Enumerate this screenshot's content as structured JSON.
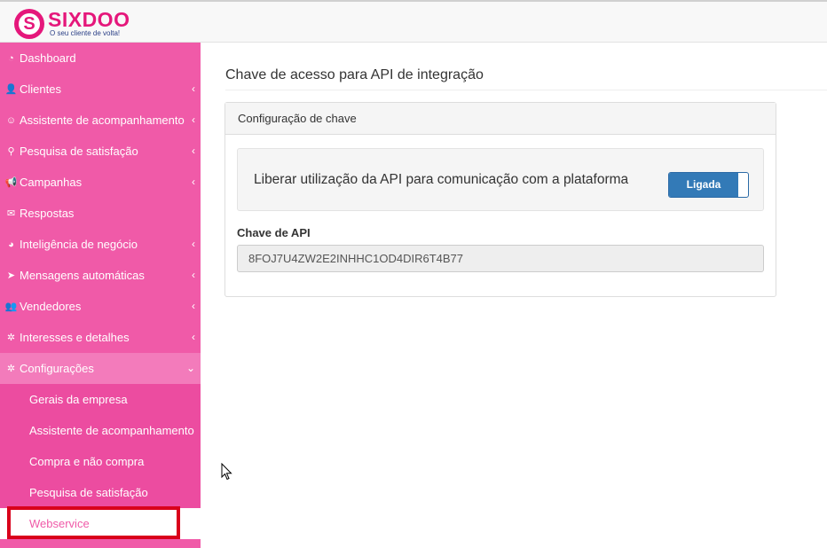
{
  "brand": {
    "name": "SIXDOO",
    "tagline": "O seu cliente de volta!",
    "mark": "S",
    "color": "#e5177b"
  },
  "sidebar": {
    "items": [
      {
        "label": "Dashboard",
        "icon": "dashboard-icon",
        "glyph": "◔",
        "has_children": false
      },
      {
        "label": "Clientes",
        "icon": "user-plus-icon",
        "glyph": "👤",
        "has_children": true
      },
      {
        "label": "Assistente de acompanhamento",
        "icon": "smile-icon",
        "glyph": "☺",
        "has_children": true
      },
      {
        "label": "Pesquisa de satisfação",
        "icon": "search-icon",
        "glyph": "⚲",
        "has_children": true
      },
      {
        "label": "Campanhas",
        "icon": "bullhorn-icon",
        "glyph": "📢",
        "has_children": true
      },
      {
        "label": "Respostas",
        "icon": "envelope-open-icon",
        "glyph": "✉",
        "has_children": false
      },
      {
        "label": "Inteligência de negócio",
        "icon": "pie-chart-icon",
        "glyph": "◕",
        "has_children": true
      },
      {
        "label": "Mensagens automáticas",
        "icon": "paper-plane-icon",
        "glyph": "➤",
        "has_children": true
      },
      {
        "label": "Vendedores",
        "icon": "users-icon",
        "glyph": "👥",
        "has_children": true
      },
      {
        "label": "Interesses e detalhes",
        "icon": "gear-icon",
        "glyph": "✲",
        "has_children": true
      },
      {
        "label": "Configurações",
        "icon": "gear-icon",
        "glyph": "✲",
        "has_children": true,
        "open": true
      }
    ],
    "sub_items": [
      {
        "label": "Gerais da empresa"
      },
      {
        "label": "Assistente de acompanhamento"
      },
      {
        "label": "Compra e não compra"
      },
      {
        "label": "Pesquisa de satisfação"
      },
      {
        "label": "Webservice",
        "active": true
      }
    ],
    "chevron_closed": "‹",
    "chevron_open": "⌄",
    "color": "#f05aa8"
  },
  "main": {
    "title": "Chave de acesso para API de integração",
    "panel": {
      "heading": "Configuração de chave",
      "toggle_label": "Liberar utilização da API para comunicação com a plataforma",
      "toggle_state": "Ligada",
      "key_label": "Chave de API",
      "key_value": "8FOJ7U4ZW2E2INHHC1OD4DIR6T4B77"
    }
  },
  "colors": {
    "accent": "#337ab7",
    "highlight_box": "#d9001b"
  }
}
